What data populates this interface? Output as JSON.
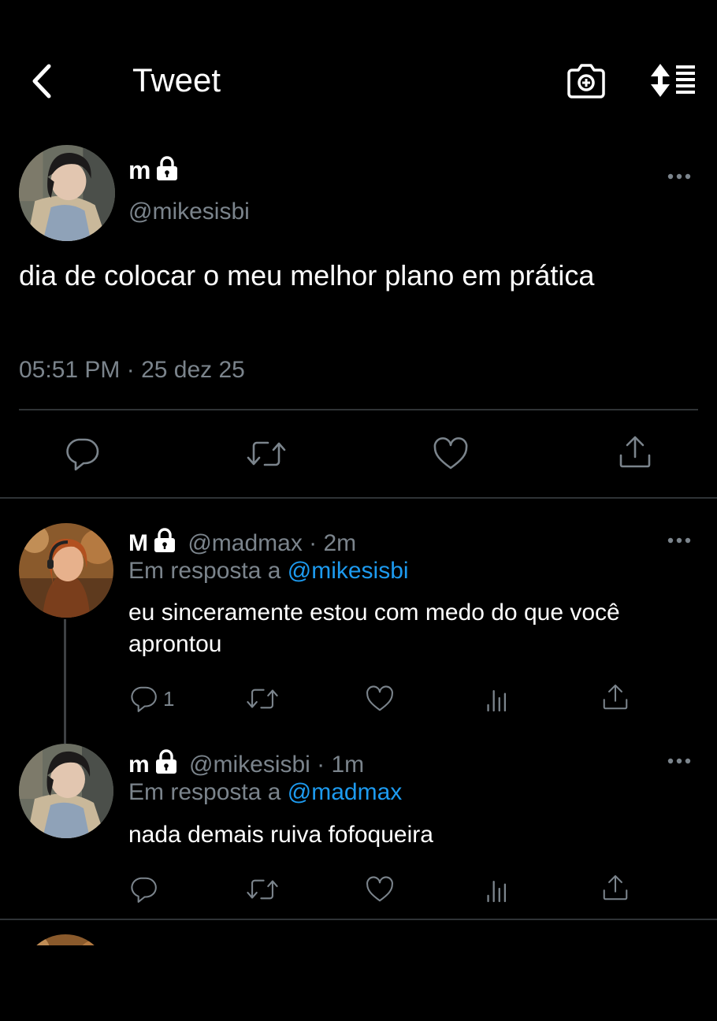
{
  "header": {
    "title": "Tweet"
  },
  "icons": {
    "back": "chevron-left-icon",
    "camera": "camera-plus-icon",
    "sort": "sort-list-icon",
    "lock": "lock-icon",
    "more": "more-dots-icon",
    "reply": "reply-bubble-icon",
    "retweet": "retweet-icon",
    "like": "heart-icon",
    "share": "share-upload-icon",
    "analytics": "analytics-bars-icon"
  },
  "colors": {
    "background": "#000000",
    "secondary_text": "#7b848c",
    "link": "#1d9bf0",
    "divider": "#2f3336"
  },
  "main_tweet": {
    "name": "m",
    "handle": "@mikesisbi",
    "text": "dia de colocar o meu melhor plano em prática",
    "timestamp": "05:51 PM · 25 dez 25"
  },
  "replies": [
    {
      "name": "M",
      "handle_time": "@madmax · 2m",
      "reply_prefix": "Em resposta a",
      "reply_to": "@mikesisbi",
      "text": "eu sinceramente estou com medo do que você aprontou",
      "reply_count": "1"
    },
    {
      "name": "m",
      "handle_time": "@mikesisbi · 1m",
      "reply_prefix": "Em resposta a",
      "reply_to": "@madmax",
      "text": "nada demais ruiva fofoqueira",
      "reply_count": ""
    }
  ]
}
